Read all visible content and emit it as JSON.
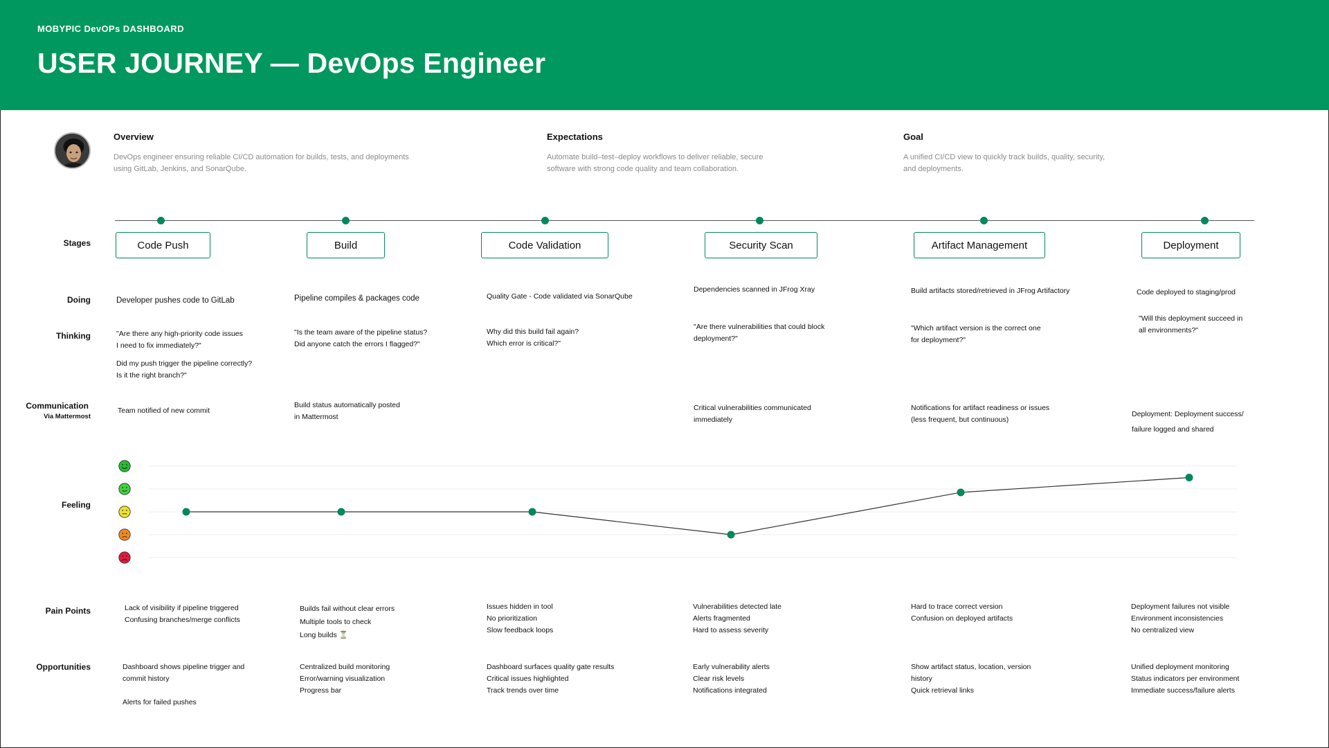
{
  "header": {
    "eyebrow": "MOBYPIC DevOPs DASHBOARD",
    "title": "USER JOURNEY — DevOps Engineer",
    "bg_color": "#00985E"
  },
  "overview": {
    "avatar": "person-avatar",
    "blocks": [
      {
        "title": "Overview",
        "lines": [
          "DevOps engineer ensuring reliable CI/CD automation for builds, tests, and deployments",
          "using GitLab, Jenkins, and SonarQube."
        ]
      },
      {
        "title": "Expectations",
        "lines": [
          "Automate build–test–deploy workflows to deliver reliable, secure",
          "software with strong code quality and team collaboration."
        ]
      },
      {
        "title": "Goal",
        "lines": [
          "A unified CI/CD view to quickly track builds, quality, security,",
          "and deployments."
        ]
      }
    ]
  },
  "row_labels": {
    "stages": "Stages",
    "doing": "Doing",
    "thinking": "Thinking",
    "communication": "Communication",
    "communication_sub": "Via Mattermost",
    "feeling": "Feeling",
    "pain_points": "Pain Points",
    "opportunities": "Opportunities"
  },
  "accent_color": "#00885A",
  "stages": [
    {
      "name": "Code Push",
      "doing": [
        "Developer pushes code to GitLab"
      ],
      "thinking": [
        "\"Are there any high-priority code issues",
        "I need to fix immediately?\"",
        "",
        "Did my push trigger the pipeline correctly?",
        "Is it the right branch?\""
      ],
      "communication": [
        "Team notified of new commit"
      ],
      "pain_points": [
        "Lack of visibility if pipeline triggered",
        "Confusing branches/merge conflicts"
      ],
      "opportunities": [
        "Dashboard shows pipeline trigger and",
        "commit history",
        "",
        "Alerts for failed pushes"
      ]
    },
    {
      "name": "Build",
      "doing": [
        "Pipeline compiles & packages code"
      ],
      "thinking": [
        "\"Is the team aware of the pipeline status?",
        "Did anyone catch the errors I flagged?\""
      ],
      "communication": [
        "Build status automatically posted",
        "in Mattermost"
      ],
      "pain_points": [
        "Builds fail without clear errors",
        "Multiple tools to check",
        "Long builds ⏳"
      ],
      "opportunities": [
        "Centralized build monitoring",
        "Error/warning visualization",
        "Progress bar"
      ]
    },
    {
      "name": "Code Validation",
      "doing": [
        "Quality Gate - Code validated via SonarQube"
      ],
      "thinking": [
        "Why did this build fail again?",
        "Which error is critical?\""
      ],
      "communication": [],
      "pain_points": [
        "Issues hidden in tool",
        "No prioritization",
        "Slow feedback loops"
      ],
      "opportunities": [
        "Dashboard surfaces quality gate results",
        "Critical issues highlighted",
        "Track trends over time"
      ]
    },
    {
      "name": "Security Scan",
      "doing": [
        "Dependencies scanned in JFrog Xray"
      ],
      "thinking": [
        "\"Are there vulnerabilities that could block",
        "deployment?\""
      ],
      "communication": [
        "Critical vulnerabilities communicated",
        "immediately"
      ],
      "pain_points": [
        "Vulnerabilities detected late",
        "Alerts fragmented",
        "Hard to assess severity"
      ],
      "opportunities": [
        "Early vulnerability alerts",
        "Clear risk levels",
        "Notifications integrated"
      ]
    },
    {
      "name": "Artifact Management",
      "doing": [
        "Build artifacts stored/retrieved in JFrog Artifactory"
      ],
      "thinking": [
        "\"Which artifact version is the correct one",
        "for deployment?\""
      ],
      "communication": [
        "Notifications for artifact readiness or issues",
        "(less frequent, but continuous)"
      ],
      "pain_points": [
        "Hard to trace correct version",
        "Confusion on deployed artifacts"
      ],
      "opportunities": [
        "Show artifact status, location, version",
        "history",
        "Quick retrieval links"
      ]
    },
    {
      "name": "Deployment",
      "doing": [
        "Code deployed to staging/prod"
      ],
      "thinking": [
        "\"Will this deployment succeed in",
        "all environments?\""
      ],
      "communication": [
        "Deployment: Deployment success/",
        "failure logged and shared"
      ],
      "pain_points": [
        "Deployment failures not visible",
        "Environment inconsistencies",
        "No centralized view"
      ],
      "opportunities": [
        "Unified deployment monitoring",
        "Status indicators per environment",
        "Immediate success/failure alerts"
      ]
    }
  ],
  "feeling": {
    "scale_faces": [
      "very-happy-face-icon",
      "happy-face-icon",
      "neutral-face-icon",
      "sad-face-icon",
      "very-sad-face-icon"
    ],
    "face_colors": [
      "#22c02e",
      "#3fd23f",
      "#f0e22a",
      "#f08a1e",
      "#e8173a"
    ],
    "levels": [
      2,
      2,
      2,
      1,
      2.85,
      3.5
    ]
  }
}
